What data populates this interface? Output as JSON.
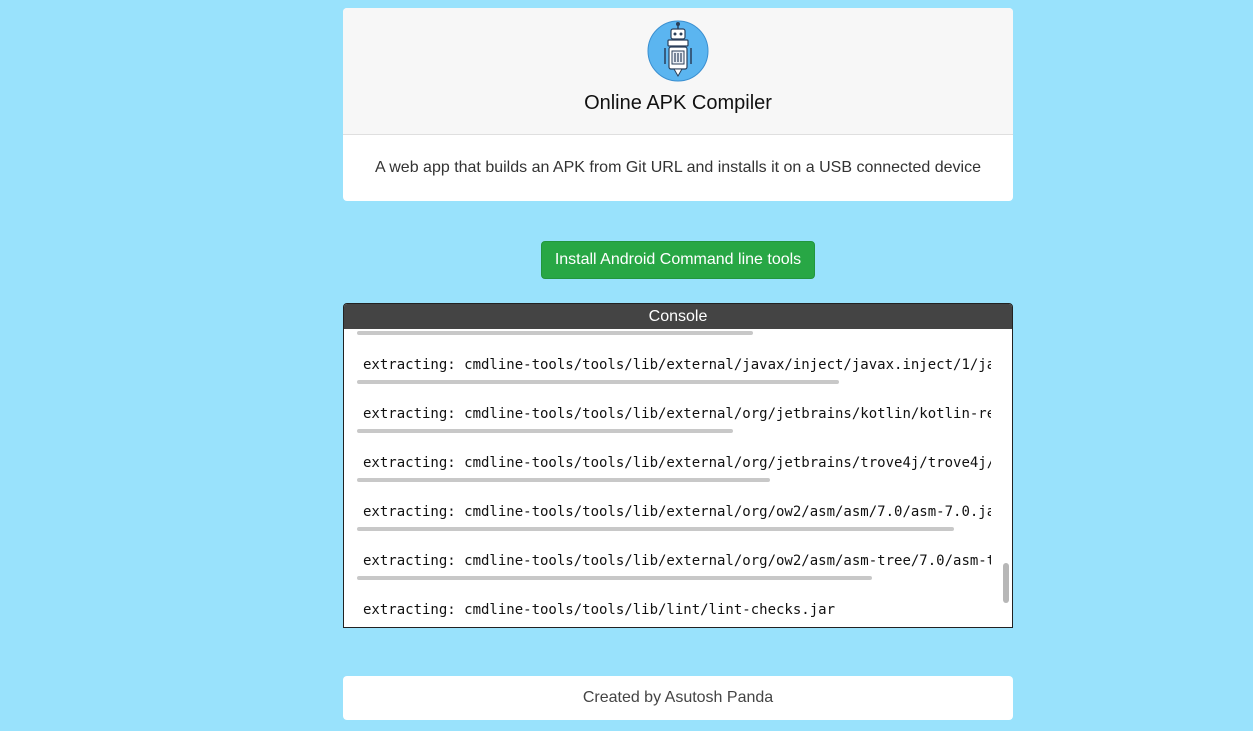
{
  "header": {
    "title": "Online APK Compiler",
    "logo_icon": "robot-logo-icon",
    "description": "A web app that builds an APK from Git URL and installs it on a USB connected device"
  },
  "actions": {
    "install_label": "Install Android Command line tools"
  },
  "console": {
    "title": "Console",
    "lines": [
      "extracting: cmdline-tools/tools/lib/external/javax/inject/javax.inject/1/ja",
      "extracting: cmdline-tools/tools/lib/external/org/jetbrains/kotlin/kotlin-re",
      "extracting: cmdline-tools/tools/lib/external/org/jetbrains/trove4j/trove4j/",
      "extracting: cmdline-tools/tools/lib/external/org/ow2/asm/asm/7.0/asm-7.0.ja",
      "extracting: cmdline-tools/tools/lib/external/org/ow2/asm/asm-tree/7.0/asm-t",
      "extracting: cmdline-tools/tools/lib/lint/lint-checks.jar"
    ]
  },
  "footer": {
    "credit": "Created by Asutosh Panda"
  },
  "colors": {
    "background": "#99e2fc",
    "button": "#28a745",
    "console_header": "#444444"
  }
}
